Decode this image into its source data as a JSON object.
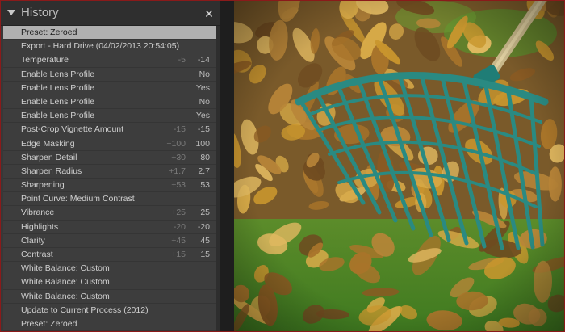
{
  "panel": {
    "title": "History",
    "items": [
      {
        "label": "Preset: Zeroed",
        "delta": "",
        "value": "",
        "selected": true
      },
      {
        "label": "Export - Hard Drive (04/02/2013 20:54:05)",
        "delta": "",
        "value": ""
      },
      {
        "label": "Temperature",
        "delta": "-5",
        "value": "-14"
      },
      {
        "label": "Enable Lens Profile",
        "delta": "",
        "value": "No"
      },
      {
        "label": "Enable Lens Profile",
        "delta": "",
        "value": "Yes"
      },
      {
        "label": "Enable Lens Profile",
        "delta": "",
        "value": "No"
      },
      {
        "label": "Enable Lens Profile",
        "delta": "",
        "value": "Yes"
      },
      {
        "label": "Post-Crop Vignette Amount",
        "delta": "-15",
        "value": "-15"
      },
      {
        "label": "Edge Masking",
        "delta": "+100",
        "value": "100"
      },
      {
        "label": "Sharpen Detail",
        "delta": "+30",
        "value": "80"
      },
      {
        "label": "Sharpen Radius",
        "delta": "+1.7",
        "value": "2.7"
      },
      {
        "label": "Sharpening",
        "delta": "+53",
        "value": "53"
      },
      {
        "label": "Point Curve: Medium Contrast",
        "delta": "",
        "value": ""
      },
      {
        "label": "Vibrance",
        "delta": "+25",
        "value": "25"
      },
      {
        "label": "Highlights",
        "delta": "-20",
        "value": "-20"
      },
      {
        "label": "Clarity",
        "delta": "+45",
        "value": "45"
      },
      {
        "label": "Contrast",
        "delta": "+15",
        "value": "15"
      },
      {
        "label": "White Balance: Custom",
        "delta": "",
        "value": ""
      },
      {
        "label": "White Balance: Custom",
        "delta": "",
        "value": ""
      },
      {
        "label": "White Balance: Custom",
        "delta": "",
        "value": ""
      },
      {
        "label": "Update to Current Process (2012)",
        "delta": "",
        "value": ""
      },
      {
        "label": "Preset: Zeroed",
        "delta": "",
        "value": ""
      }
    ]
  },
  "icons": {
    "collapse": "triangle-down-icon",
    "close": "close-icon"
  },
  "colors": {
    "panel_bg": "#383838",
    "selected_row": "#b0b0b0",
    "frame_border": "#8a1a1a",
    "rake": "#2a8a82",
    "grass": "#4a8a2a",
    "leaf": "#c9962e"
  }
}
